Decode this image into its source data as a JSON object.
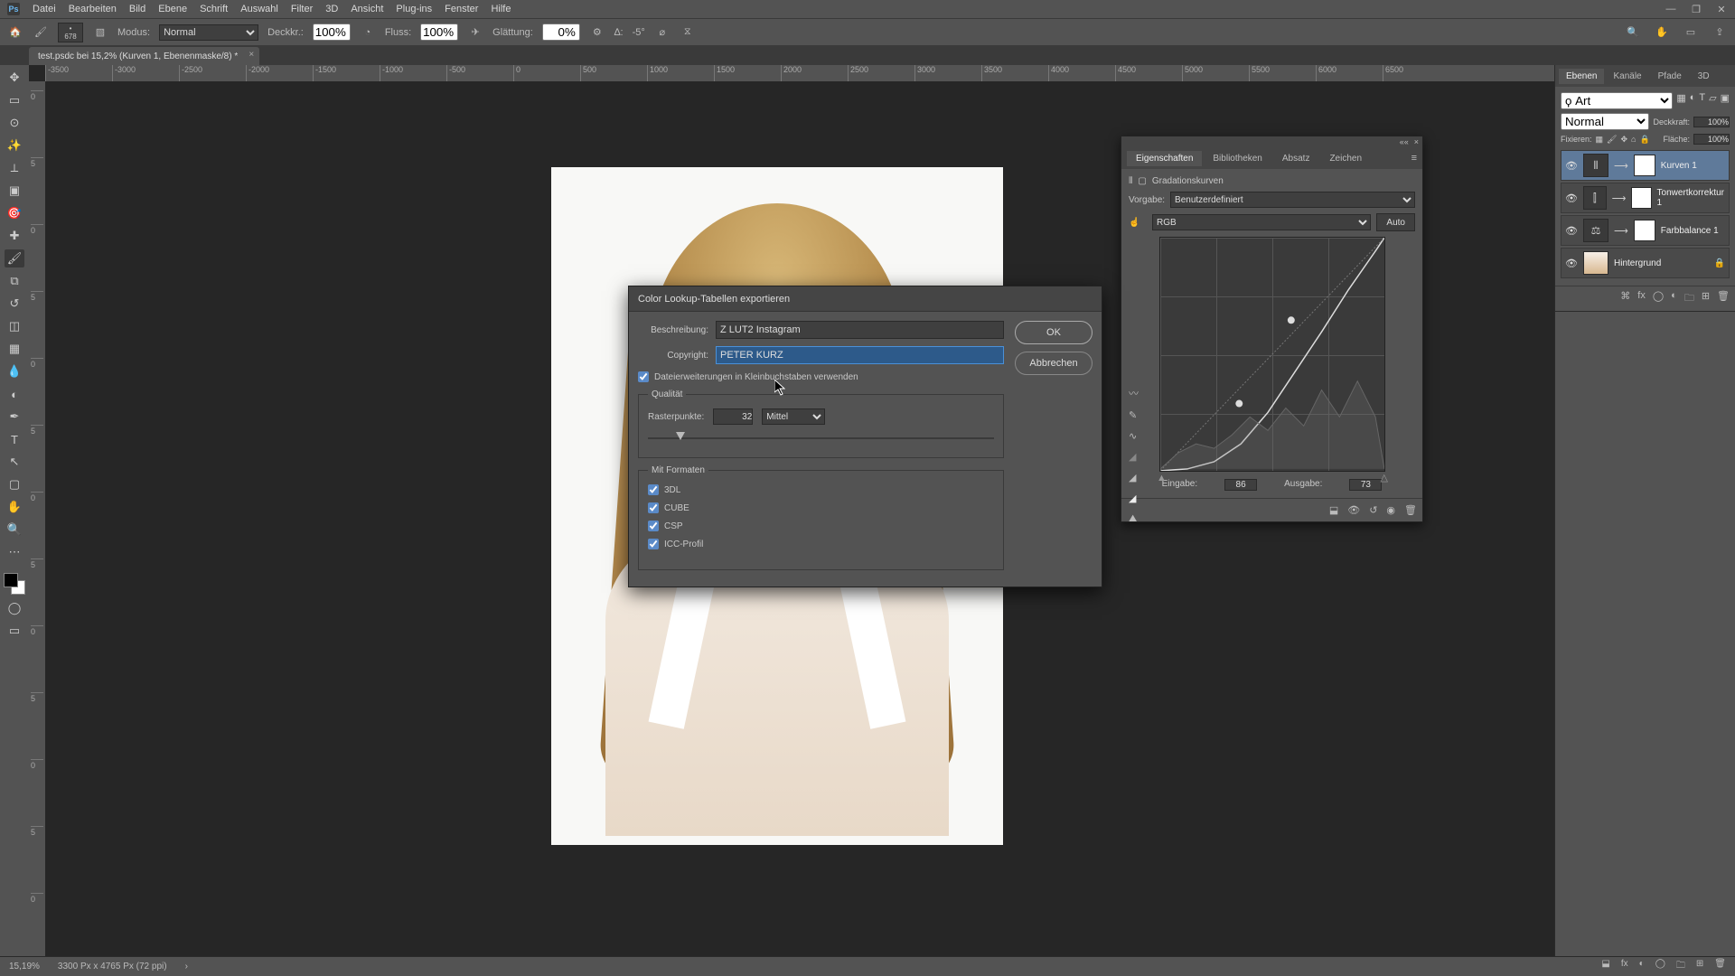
{
  "menubar": {
    "items": [
      "Datei",
      "Bearbeiten",
      "Bild",
      "Ebene",
      "Schrift",
      "Auswahl",
      "Filter",
      "3D",
      "Ansicht",
      "Plug-ins",
      "Fenster",
      "Hilfe"
    ]
  },
  "options": {
    "brush_size": "678",
    "mode_label": "Modus:",
    "mode_value": "Normal",
    "opacity_label": "Deckkr.:",
    "opacity_value": "100%",
    "flow_label": "Fluss:",
    "flow_value": "100%",
    "smoothing_label": "Glättung:",
    "smoothing_value": "0%",
    "angle_label": "∆:",
    "angle_value": "-5°"
  },
  "doc_tab": {
    "title": "test.psdc bei 15,2% (Kurven 1, Ebenenmaske/8) *"
  },
  "ruler_h": [
    "-3500",
    "-3000",
    "-2500",
    "-2000",
    "-1500",
    "-1000",
    "-500",
    "0",
    "500",
    "1000",
    "1500",
    "2000",
    "2500",
    "3000",
    "3500",
    "4000",
    "4500",
    "5000",
    "5500",
    "6000",
    "6500"
  ],
  "ruler_v": [
    "0",
    "5",
    "0",
    "5",
    "0",
    "5",
    "0",
    "5",
    "0",
    "5",
    "0",
    "5",
    "0",
    "5",
    "0",
    "5"
  ],
  "props_panel": {
    "tabs": [
      "Eigenschaften",
      "Bibliotheken",
      "Absatz",
      "Zeichen"
    ],
    "type_label": "Gradationskurven",
    "preset_label": "Vorgabe:",
    "preset_value": "Benutzerdefiniert",
    "channel_value": "RGB",
    "auto_label": "Auto",
    "input_label": "Eingabe:",
    "input_value": "86",
    "output_label": "Ausgabe:",
    "output_value": "73"
  },
  "layers_panel": {
    "tabs": [
      "Ebenen",
      "Kanäle",
      "Pfade",
      "3D"
    ],
    "filter_label": "ϙ Art",
    "blend_value": "Normal",
    "opacity_label": "Deckkraft:",
    "opacity_value": "100%",
    "lock_label": "Fixieren:",
    "fill_label": "Fläche:",
    "fill_value": "100%",
    "layers": [
      {
        "name": "Kurven 1",
        "adj": true,
        "active": true
      },
      {
        "name": "Tonwertkorrektur 1",
        "adj": true
      },
      {
        "name": "Farbbalance 1",
        "adj": true
      },
      {
        "name": "Hintergrund",
        "locked": true
      }
    ]
  },
  "dialog": {
    "title": "Color Lookup-Tabellen exportieren",
    "desc_label": "Beschreibung:",
    "desc_value": "Z LUT2 Instagram",
    "copy_label": "Copyright:",
    "copy_value": "PETER KURZ",
    "lowercase_label": "Dateierweiterungen in Kleinbuchstaben verwenden",
    "quality_legend": "Qualität",
    "grid_label": "Rasterpunkte:",
    "grid_value": "32",
    "grid_preset": "Mittel",
    "formats_legend": "Mit Formaten",
    "formats": [
      "3DL",
      "CUBE",
      "CSP",
      "ICC-Profil"
    ],
    "ok": "OK",
    "cancel": "Abbrechen"
  },
  "statusbar": {
    "zoom": "15,19%",
    "dims": "3300 Px x 4765 Px (72 ppi)"
  }
}
